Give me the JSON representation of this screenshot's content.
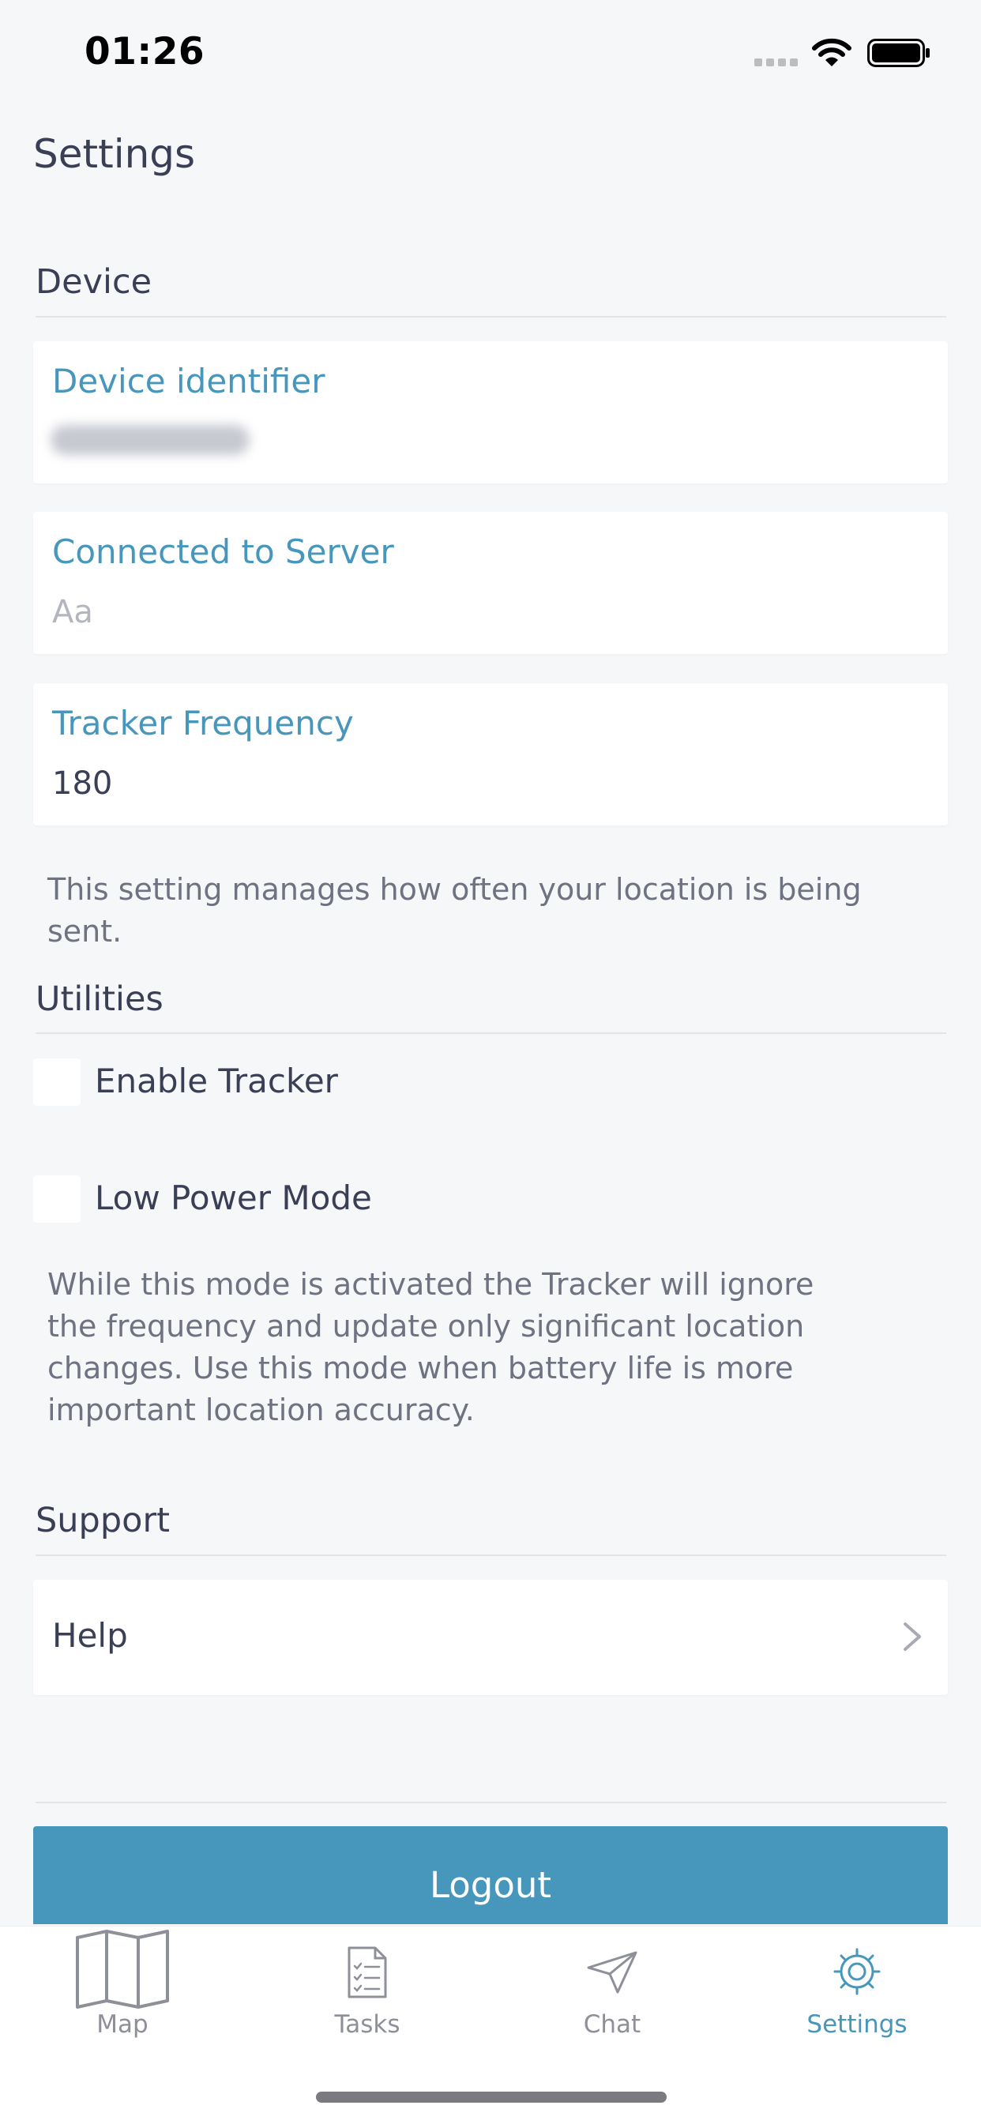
{
  "status_bar": {
    "time": "01:26"
  },
  "page_title": "Settings",
  "sections": {
    "device": "Device",
    "utilities": "Utilities",
    "support": "Support"
  },
  "device": {
    "identifier_label": "Device identifier",
    "server_label": "Connected to Server",
    "server_placeholder": "Aa",
    "frequency_label": "Tracker Frequency",
    "frequency_value": "180",
    "frequency_note": "This setting manages how often your location is being sent."
  },
  "utilities": {
    "enable_tracker": {
      "label": "Enable Tracker",
      "checked": false
    },
    "low_power_mode": {
      "label": "Low Power Mode",
      "checked": false
    },
    "low_power_note": "While this mode is activated the Tracker will ignore the frequency and update only significant location changes. Use this mode when battery life is more important location accuracy."
  },
  "support": {
    "help_label": "Help"
  },
  "logout_label": "Logout",
  "tabs": [
    {
      "label": "Map",
      "icon": "map-icon",
      "active": false
    },
    {
      "label": "Tasks",
      "icon": "tasks-icon",
      "active": false
    },
    {
      "label": "Chat",
      "icon": "paper-plane-icon",
      "active": false
    },
    {
      "label": "Settings",
      "icon": "gear-icon",
      "active": true
    }
  ],
  "colors": {
    "accent": "#4796bc",
    "background": "#f6f7f9",
    "text": "#3a3f55"
  }
}
